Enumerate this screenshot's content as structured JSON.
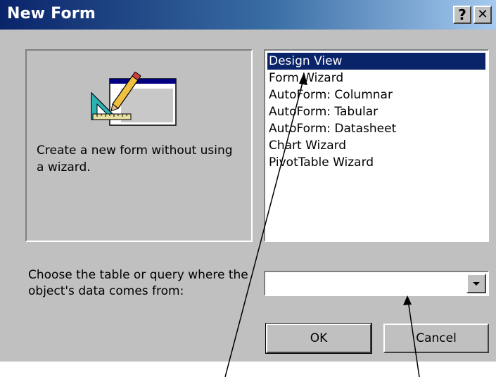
{
  "window": {
    "title": "New Form",
    "help_label": "?",
    "close_label": "✕"
  },
  "preview": {
    "description": "Create a new form without using a wizard.",
    "icon": "form-design-icon"
  },
  "form_types": {
    "items": [
      {
        "label": "Design View",
        "selected": true
      },
      {
        "label": "Form Wizard",
        "selected": false
      },
      {
        "label": "AutoForm:  Columnar",
        "selected": false
      },
      {
        "label": "AutoForm:  Tabular",
        "selected": false
      },
      {
        "label": "AutoForm:  Datasheet",
        "selected": false
      },
      {
        "label": "Chart Wizard",
        "selected": false
      },
      {
        "label": "PivotTable Wizard",
        "selected": false
      }
    ]
  },
  "source": {
    "label": "Choose the table or query where the object's data comes from:",
    "value": ""
  },
  "buttons": {
    "ok_label": "OK",
    "cancel_label": "Cancel"
  },
  "colors": {
    "titlebar_start": "#0a246a",
    "titlebar_end": "#a6caf0",
    "face": "#c0c0c0",
    "selection": "#0a246a"
  }
}
